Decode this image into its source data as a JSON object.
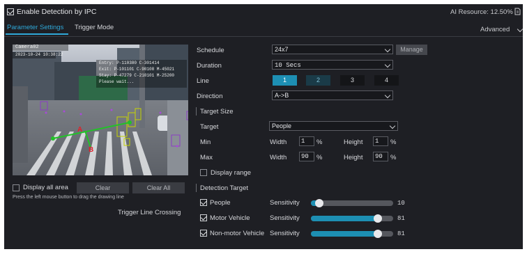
{
  "header": {
    "enable_label": "Enable Detection by IPC",
    "ai_resource": "AI Resource: 12.50%"
  },
  "tabs": [
    {
      "label": "Parameter Settings"
    },
    {
      "label": "Trigger Mode"
    }
  ],
  "advanced_label": "Advanced",
  "preview": {
    "camera_name": "Camera02",
    "timestamp": "2023-10-24  10:38:22",
    "stats": [
      "Entry: P-110380  C-301414",
      "Exit: P-101101  C-90108  M-45021",
      "Stay: P-47279  C-210101  M-25200",
      "Please wait..."
    ],
    "point_a": "A",
    "point_b": "B"
  },
  "left_controls": {
    "display_all_area": "Display all area",
    "clear": "Clear",
    "clear_all": "Clear All",
    "hint": "Press the left mouse button to drag the drawing line",
    "caption": "Trigger Line Crossing"
  },
  "form": {
    "schedule_label": "Schedule",
    "schedule_value": "24x7",
    "manage": "Manage",
    "duration_label": "Duration",
    "duration_value": "10 Secs",
    "line_label": "Line",
    "lines": [
      "1",
      "2",
      "3",
      "4"
    ],
    "direction_label": "Direction",
    "direction_value": "A->B",
    "target_size_title": "Target Size",
    "target_label": "Target",
    "target_value": "People",
    "min_label": "Min",
    "max_label": "Max",
    "width_label": "Width",
    "height_label": "Height",
    "min_width": "1",
    "min_height": "1",
    "max_width": "90",
    "max_height": "90",
    "percent": "%",
    "display_range": "Display range",
    "detection_target_title": "Detection Target",
    "sensitivity_label": "Sensitivity",
    "targets": [
      {
        "name": "People",
        "value": "10",
        "level": 0.1
      },
      {
        "name": "Motor Vehicle",
        "value": "81",
        "level": 0.81
      },
      {
        "name": "Non-motor Vehicle",
        "value": "81",
        "level": 0.81
      }
    ]
  },
  "colors": {
    "accent": "#1d8fb3",
    "panel": "#1e1f24"
  }
}
